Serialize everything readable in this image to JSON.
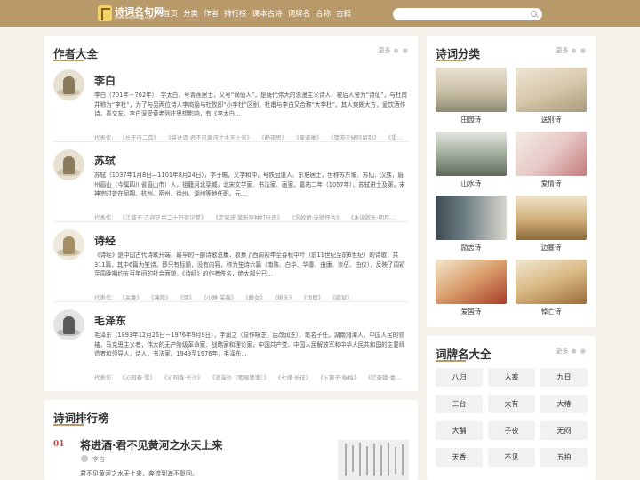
{
  "header": {
    "logo_text": "诗词名句网",
    "logo_sub": "Www.ShiCiMingJu.Com",
    "nav": [
      "首页",
      "分类",
      "作者",
      "排行榜",
      "课本古诗",
      "词牌名",
      "合称",
      "古籍"
    ]
  },
  "authors_section": {
    "title": "作者大全",
    "more": "更多",
    "works_prefix": "代表作:",
    "authors": [
      {
        "name": "李白",
        "desc": "李白（701年－762年），字太白，号青莲居士，又号“谪仙人”，是唐代伟大的浪漫主义诗人，被后人誉为“诗仙”，与杜甫并称为“李杜”，为了与另两位诗人李商隐与杜牧即“小李杜”区别，杜甫与李白又合称“大李杜”。其人爽朗大方，爱饮酒作诗，喜交友。李白深受黄老列庄思想影响，有《李太白...",
        "works": [
          "《长干行二首》",
          "《将进酒·君不见黄河之水天上来》",
          "《静夜思》",
          "《蜀道难》",
          "《梦游天姥吟留别》",
          "《望..."
        ]
      },
      {
        "name": "苏轼",
        "desc": "苏轼（1037年1月8日—1101年8月24日），字子瞻，又字和仲，号铁冠道人、东坡居士，世称苏东坡、苏仙、汉族，眉州眉山（今属四川省眉山市）人，祖籍河北栾城，北宋文学家、书法家、画家。嘉祐二年（1057年），苏轼进士及第。宋神宗时曾在凤翔、杭州、密州、徐州、湖州等地任职。元...",
        "works": [
          "《江城子·乙卯正月二十日夜记梦》",
          "《定风波·莫听穿林打叶声》",
          "《念奴娇·赤壁怀古》",
          "《水调歌头·明月..."
        ]
      },
      {
        "name": "诗经",
        "desc": "《诗经》是中国古代诗歌开端，最早的一部诗歌总集，收集了西周初年至春秋中叶（前11世纪至前6世纪）的诗歌，共311篇，其中6篇为笙诗，即只有标题，没有内容，称为笙诗六篇（南陔、白华、华黍、由康、崇伍、由仪），反映了周初至周晚期约五百年间的社会面貌。《诗经》的作者佚名，绝大部分已...",
        "works": [
          "《关雎》",
          "《蒹葭》",
          "《氓》",
          "《小雅·采薇》",
          "《静女》",
          "《桃夭》",
          "《伐檀》",
          "《硕鼠》"
        ]
      },
      {
        "name": "毛泽东",
        "desc": "毛泽东（1893年12月26日－1976年9月9日），字润之（原作咏芝，后改润芝），笔名子任。湖南湘潭人。中国人民的领袖，马克思主义者，伟大的无产阶级革命家、战略家和理论家，中国共产党、中国人民解放军和中华人民共和国的主要缔造者和领导人，诗人，书法家。1949至1976年，毛泽东...",
        "works": [
          "《沁园春·雪》",
          "《沁园春·长沙》",
          "《浪淘沙（咽喉要率）》",
          "《七律·长征》",
          "《卜算子·咏梅》",
          "《忆秦娥·娄..."
        ]
      }
    ]
  },
  "ranking_section": {
    "title": "诗词排行榜",
    "items": [
      {
        "rank": "01",
        "title": "将进酒·君不见黄河之水天上来",
        "author": "李白",
        "first_line": "君不见黄河之水天上来，奔流到海不复回。"
      }
    ]
  },
  "category_section": {
    "title": "诗词分类",
    "more": "更多",
    "categories": [
      "田园诗",
      "送别诗",
      "山水诗",
      "爱情诗",
      "励志诗",
      "边塞诗",
      "爱国诗",
      "悼亡诗"
    ]
  },
  "cipai_section": {
    "title": "词牌名大全",
    "more": "更多",
    "tags": [
      "八归",
      "入塞",
      "九日",
      "三台",
      "大有",
      "大椿",
      "大酺",
      "子夜",
      "无闷",
      "天香",
      "不见",
      "五拍"
    ]
  },
  "colors": {
    "header_bg": "#b8996a",
    "page_bg": "#f4f1ea",
    "rank_number": "#cc4444"
  }
}
